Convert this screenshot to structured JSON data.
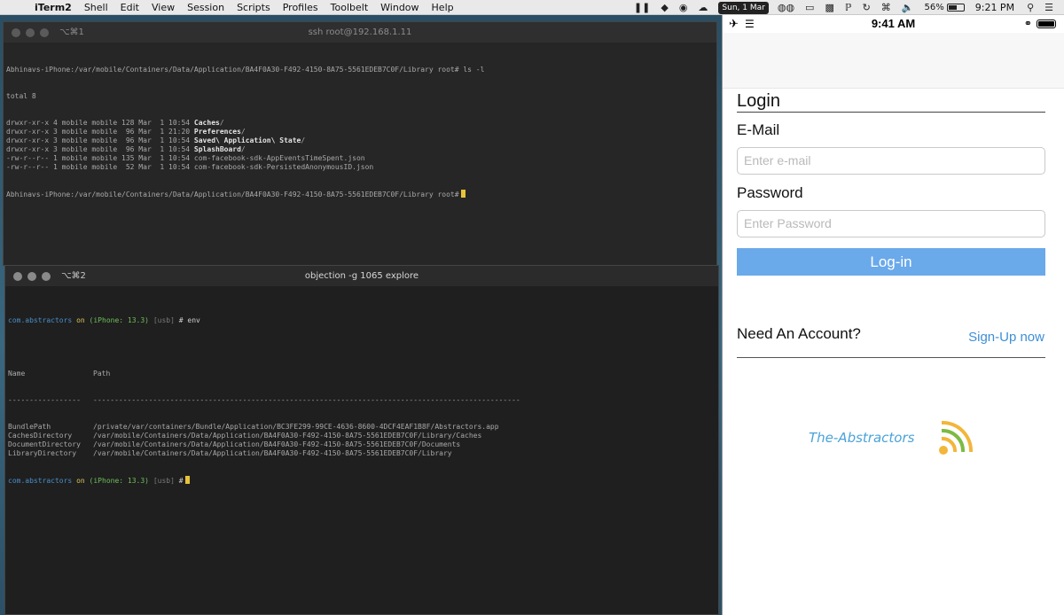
{
  "menubar": {
    "app_name": "iTerm2",
    "menus": [
      "Shell",
      "Edit",
      "View",
      "Session",
      "Scripts",
      "Profiles",
      "Toolbelt",
      "Window",
      "Help"
    ],
    "date": "Sun, 1 Mar",
    "battery_percent": "56%",
    "battery_level": 0.56,
    "time": "9:21 PM"
  },
  "terminal_top": {
    "tab_shortcut": "⌥⌘1",
    "title": "ssh root@192.168.1.11",
    "prompt_command": "Abhinavs-iPhone:/var/mobile/Containers/Data/Application/BA4F0A30-F492-4150-8A75-5561EDEB7C0F/Library root# ls -l",
    "total": "total 8",
    "entries": [
      {
        "meta": "drwxr-xr-x 4 mobile mobile 128 Mar  1 10:54 ",
        "name": "Caches",
        "suffix": "/",
        "bold": true
      },
      {
        "meta": "drwxr-xr-x 3 mobile mobile  96 Mar  1 21:20 ",
        "name": "Preferences",
        "suffix": "/",
        "bold": true
      },
      {
        "meta": "drwxr-xr-x 3 mobile mobile  96 Mar  1 10:54 ",
        "name": "Saved\\ Application\\ State",
        "suffix": "/",
        "bold": true
      },
      {
        "meta": "drwxr-xr-x 3 mobile mobile  96 Mar  1 10:54 ",
        "name": "SplashBoard",
        "suffix": "/",
        "bold": true
      },
      {
        "meta": "-rw-r--r-- 1 mobile mobile 135 Mar  1 10:54 ",
        "name": "com-facebook-sdk-AppEventsTimeSpent.json",
        "suffix": "",
        "bold": false
      },
      {
        "meta": "-rw-r--r-- 1 mobile mobile  52 Mar  1 10:54 ",
        "name": "com-facebook-sdk-PersistedAnonymousID.json",
        "suffix": "",
        "bold": false
      }
    ],
    "final_prompt": "Abhinavs-iPhone:/var/mobile/Containers/Data/Application/BA4F0A30-F492-4150-8A75-5561EDEB7C0F/Library root#"
  },
  "terminal_bottom": {
    "tab_shortcut": "⌥⌘2",
    "title": "objection -g 1065 explore",
    "prompt": {
      "app": "com.abstractors",
      "on": "on",
      "device": "(iPhone: 13.3)",
      "transport": "[usb]",
      "hash": "#",
      "command": "env"
    },
    "table_header_name": "Name",
    "table_header_path": "Path",
    "table_rule_name": "-----------------",
    "table_rule_path": "----------------------------------------------------------------------------------------------------",
    "env": [
      {
        "name": "BundlePath",
        "path": "/private/var/containers/Bundle/Application/BC3FE299-99CE-4636-8600-4DCF4EAF1B8F/Abstractors.app"
      },
      {
        "name": "CachesDirectory",
        "path": "/var/mobile/Containers/Data/Application/BA4F0A30-F492-4150-8A75-5561EDEB7C0F/Library/Caches"
      },
      {
        "name": "DocumentDirectory",
        "path": "/var/mobile/Containers/Data/Application/BA4F0A30-F492-4150-8A75-5561EDEB7C0F/Documents"
      },
      {
        "name": "LibraryDirectory",
        "path": "/var/mobile/Containers/Data/Application/BA4F0A30-F492-4150-8A75-5561EDEB7C0F/Library"
      }
    ]
  },
  "phone": {
    "status_time": "9:41 AM",
    "login_title": "Login",
    "email_label": "E-Mail",
    "email_placeholder": "Enter e-mail",
    "password_label": "Password",
    "password_placeholder": "Enter Password",
    "login_button": "Log-in",
    "need_account": "Need An Account?",
    "signup_link": "Sign-Up now",
    "brand": "The-Abstractors",
    "colors": {
      "button": "#6aa9ea",
      "link": "#3d8fd6",
      "brand_text": "#4aa3d8",
      "brand_arc_green": "#7dbb42",
      "brand_arc_yellow": "#f2b63a"
    }
  }
}
